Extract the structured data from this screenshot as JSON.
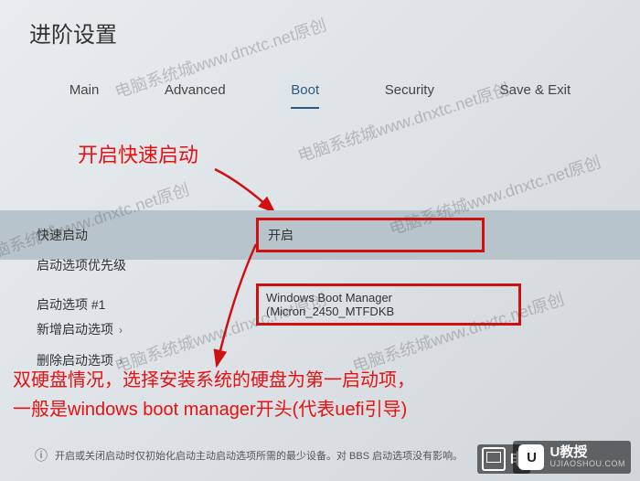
{
  "page_title": "进阶设置",
  "tabs": {
    "main": "Main",
    "advanced": "Advanced",
    "boot": "Boot",
    "security": "Security",
    "save_exit": "Save & Exit"
  },
  "annotations": {
    "fastboot_hint": "开启快速启动",
    "dualdrive_line1": "双硬盘情况，选择安装系统的硬盘为第一启动项，",
    "dualdrive_line2": "一般是windows boot manager开头(代表uefi引导)"
  },
  "settings": {
    "fastboot": {
      "label": "快速启动",
      "value": "开启"
    },
    "boot_priority": {
      "label": "启动选项优先级"
    },
    "boot_option_1": {
      "label": "启动选项 #1",
      "value": "Windows Boot Manager (Micron_2450_MTFDKB"
    },
    "new_boot_option": {
      "label": "新增启动选项"
    },
    "delete_boot_option": {
      "label": "删除启动选项"
    }
  },
  "footer": {
    "text": "开启或关闭启动时仅初始化启动主动启动选项所需的最少设备。对 BBS 启动选项没有影响。"
  },
  "watermarks": {
    "text": "电脑系统城www.dnxtc.net原创"
  },
  "logos": {
    "right_badge": "U",
    "right_main": "U教授",
    "right_sub": "UJIAOSHOU.COM",
    "left_text": "电"
  }
}
